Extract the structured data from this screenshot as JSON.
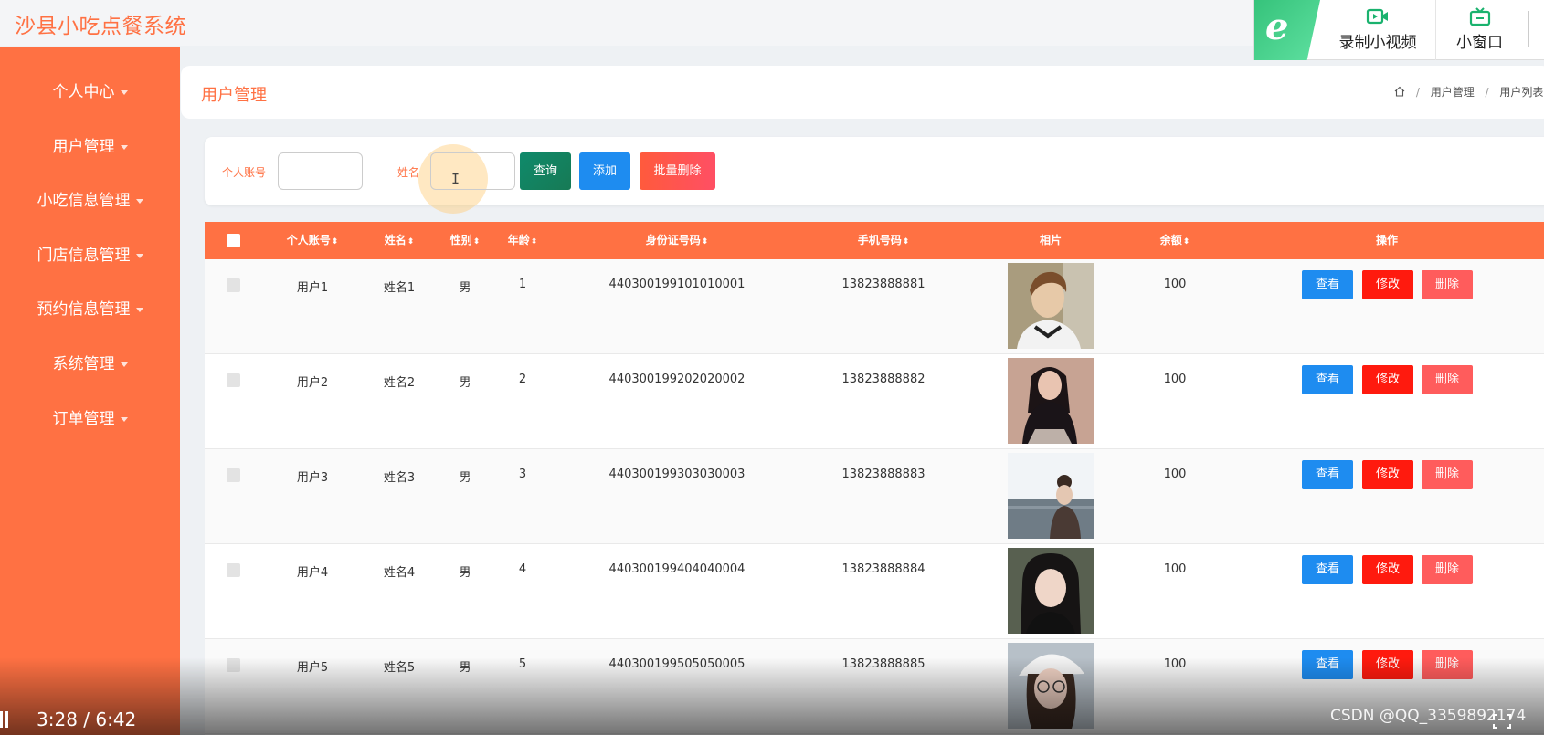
{
  "app": {
    "title": "沙县小吃点餐系统"
  },
  "recorder": {
    "record_label": "录制小视频",
    "mini_window_label": "小窗口",
    "accent_color": "#1ab26e"
  },
  "sidebar": {
    "color": "#ff7143",
    "items": [
      {
        "label": "个人中心"
      },
      {
        "label": "用户管理"
      },
      {
        "label": "小吃信息管理"
      },
      {
        "label": "门店信息管理"
      },
      {
        "label": "预约信息管理"
      },
      {
        "label": "系统管理"
      },
      {
        "label": "订单管理"
      }
    ]
  },
  "header": {
    "title": "用户管理",
    "breadcrumb": [
      "用户管理",
      "用户列表"
    ]
  },
  "search": {
    "account_label": "个人账号",
    "account_value": "",
    "name_label": "姓名",
    "name_value": "",
    "query_button": "查询",
    "add_button": "添加",
    "batch_delete_button": "批量删除"
  },
  "table": {
    "headers": {
      "account": "个人账号",
      "name": "姓名",
      "gender": "性别",
      "age": "年龄",
      "id_card": "身份证号码",
      "phone": "手机号码",
      "photo": "相片",
      "balance": "余额",
      "actions": "操作"
    },
    "sort_icon": "sort-icon",
    "rows": [
      {
        "account": "用户1",
        "name": "姓名1",
        "gender": "男",
        "age": "1",
        "id_card": "440300199101010001",
        "phone": "13823888881",
        "balance": "100"
      },
      {
        "account": "用户2",
        "name": "姓名2",
        "gender": "男",
        "age": "2",
        "id_card": "440300199202020002",
        "phone": "13823888882",
        "balance": "100"
      },
      {
        "account": "用户3",
        "name": "姓名3",
        "gender": "男",
        "age": "3",
        "id_card": "440300199303030003",
        "phone": "13823888883",
        "balance": "100"
      },
      {
        "account": "用户4",
        "name": "姓名4",
        "gender": "男",
        "age": "4",
        "id_card": "440300199404040004",
        "phone": "13823888884",
        "balance": "100"
      },
      {
        "account": "用户5",
        "name": "姓名5",
        "gender": "男",
        "age": "5",
        "id_card": "440300199505050005",
        "phone": "13823888885",
        "balance": "100"
      }
    ],
    "row_actions": {
      "view": "查看",
      "edit": "修改",
      "delete": "删除"
    }
  },
  "video": {
    "time": "3:28 / 6:42",
    "watermark": "CSDN @QQ_3359892174"
  }
}
